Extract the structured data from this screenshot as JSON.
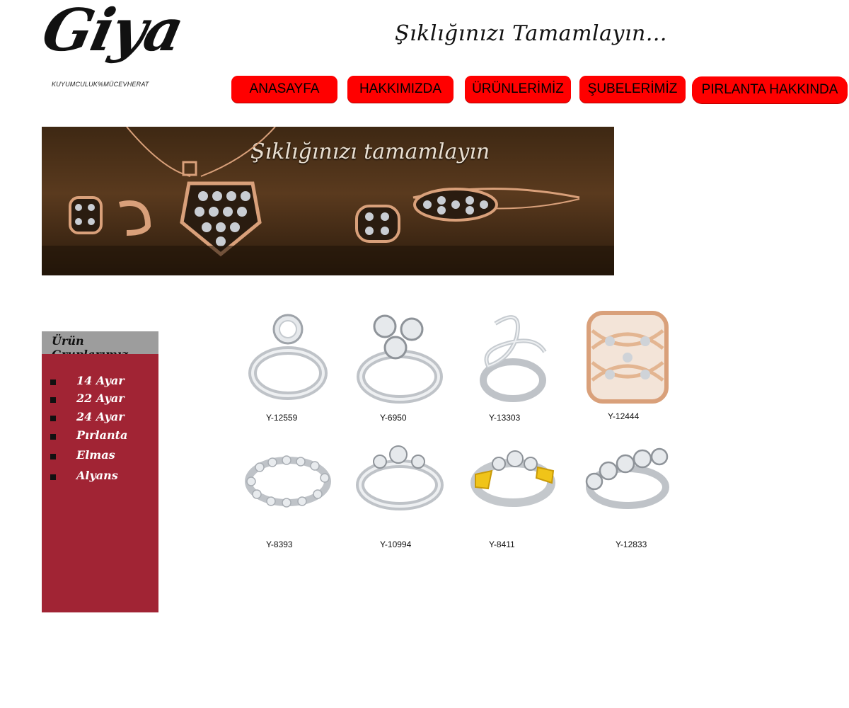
{
  "logo": {
    "text": "Giya",
    "subtitle": "KUYUMCULUK%MÜCEVHERAT"
  },
  "slogan": "Şıklığınızı Tamamlayın...",
  "nav": [
    "ANASAYFA",
    "HAKKIMIZDA",
    "ÜRÜNLERİMİZ",
    "ŞUBELERİMİZ",
    "PIRLANTA HAKKINDA"
  ],
  "banner": {
    "title": "Şıklığınızı tamamlayın"
  },
  "sidebar": {
    "title": "Ürün Gruplarımız",
    "items": [
      "14 Ayar",
      "22 Ayar",
      "24 Ayar",
      "Pırlanta",
      "Elmas",
      "Alyans"
    ]
  },
  "products": [
    {
      "code": "Y-12559"
    },
    {
      "code": "Y-6950"
    },
    {
      "code": "Y-13303"
    },
    {
      "code": "Y-12444"
    },
    {
      "code": "Y-8393"
    },
    {
      "code": "Y-10994"
    },
    {
      "code": "Y-8411"
    },
    {
      "code": "Y-12833"
    }
  ],
  "colors": {
    "nav_button": "#ff0000",
    "sidebar_body": "#a12434",
    "sidebar_header": "#9d9d9d",
    "banner_bg": "#4a2f17",
    "gold_rose": "#d9a07a"
  }
}
